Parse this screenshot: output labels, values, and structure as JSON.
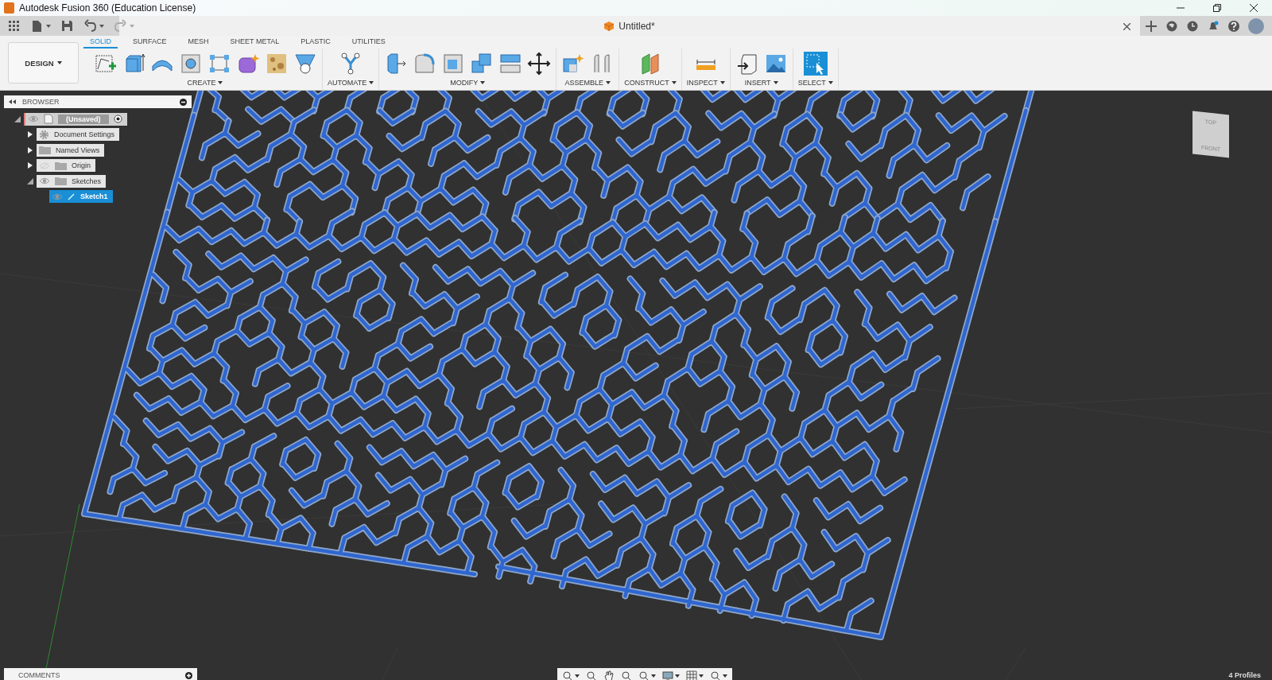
{
  "window": {
    "title": "Autodesk Fusion 360 (Education License)"
  },
  "quick_access": [
    {
      "kind": "apps",
      "disabled": false
    },
    {
      "kind": "file",
      "disabled": false
    },
    {
      "kind": "save",
      "disabled": false
    },
    {
      "kind": "undo",
      "disabled": false
    },
    {
      "kind": "redo",
      "disabled": true
    }
  ],
  "document_tab": {
    "title": "Untitled*"
  },
  "workspace": {
    "label": "DESIGN"
  },
  "tabs": [
    {
      "label": "SOLID",
      "selected": true
    },
    {
      "label": "SURFACE",
      "selected": false
    },
    {
      "label": "MESH",
      "selected": false
    },
    {
      "label": "SHEET METAL",
      "selected": false
    },
    {
      "label": "PLASTIC",
      "selected": false
    },
    {
      "label": "UTILITIES",
      "selected": false
    }
  ],
  "groups": [
    {
      "label": "CREATE",
      "tools": [
        {
          "kind": "sketch"
        },
        {
          "kind": "box"
        },
        {
          "kind": "arc-shape"
        },
        {
          "kind": "hole"
        },
        {
          "kind": "pattern"
        },
        {
          "kind": "form"
        },
        {
          "kind": "texture"
        },
        {
          "kind": "funnel"
        }
      ]
    },
    {
      "label": "AUTOMATE",
      "tools": [
        {
          "kind": "node-graph"
        }
      ]
    },
    {
      "label": "MODIFY",
      "tools": [
        {
          "kind": "push-pull"
        },
        {
          "kind": "fillet"
        },
        {
          "kind": "shell"
        },
        {
          "kind": "cubes"
        },
        {
          "kind": "split"
        },
        {
          "kind": "move"
        }
      ]
    },
    {
      "label": "ASSEMBLE",
      "tools": [
        {
          "kind": "component"
        },
        {
          "kind": "joint"
        }
      ]
    },
    {
      "label": "CONSTRUCT",
      "tools": [
        {
          "kind": "planes"
        }
      ]
    },
    {
      "label": "INSPECT",
      "tools": [
        {
          "kind": "ruler"
        }
      ]
    },
    {
      "label": "INSERT",
      "tools": [
        {
          "kind": "insert"
        },
        {
          "kind": "image"
        }
      ]
    },
    {
      "label": "SELECT",
      "tools": [
        {
          "kind": "select"
        }
      ]
    }
  ],
  "browser": {
    "title": "BROWSER",
    "tree": [
      {
        "label": "(Unsaved)",
        "kind": "document",
        "visible": true,
        "expanded": true,
        "selected": false,
        "children": [
          {
            "label": "Document Settings",
            "kind": "gear",
            "expanded": false,
            "selected": false
          },
          {
            "label": "Named Views",
            "kind": "folder",
            "expanded": false,
            "selected": false
          },
          {
            "label": "Origin",
            "kind": "folder",
            "visible": false,
            "expanded": false,
            "selected": false
          },
          {
            "label": "Sketches",
            "kind": "folder",
            "visible": true,
            "expanded": true,
            "selected": false,
            "children": [
              {
                "label": "Sketch1",
                "kind": "sketch",
                "visible": true,
                "selected": true
              }
            ]
          }
        ]
      }
    ]
  },
  "view_cube": {
    "top": "TOP",
    "front": "FRONT"
  },
  "comments": {
    "title": "COMMENTS"
  },
  "status_bar": {
    "profiles": "4 Profiles"
  }
}
